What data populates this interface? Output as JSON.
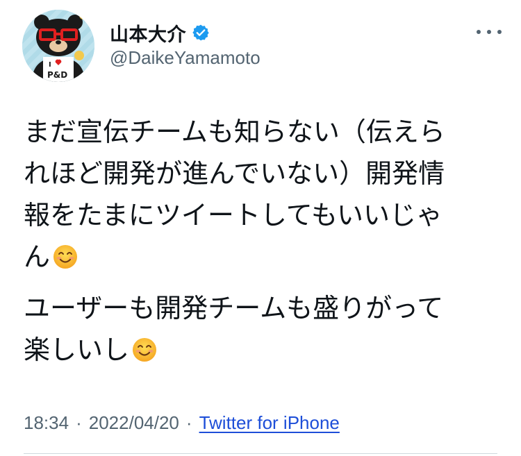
{
  "user": {
    "display_name": "山本大介",
    "handle": "@DaikeYamamoto",
    "verified": true,
    "avatar": {
      "icon": "bear-mascot-avatar",
      "background_color": "#bfe3ee",
      "shirt_text": "I ♥ P&D"
    }
  },
  "menu": {
    "icon": "more-horizontal-icon"
  },
  "tweet": {
    "lines_para1": [
      "まだ宣伝チームも知らない（伝えら",
      "れほど開発が進んでいない）開発情",
      "報をたまにツイートしてもいいじゃ",
      "ん"
    ],
    "lines_para2": [
      "ユーザーも開発チームも盛りがって",
      "楽しいし"
    ],
    "emoji": "smiling-face-icon"
  },
  "meta": {
    "time": "18:34",
    "separator": "·",
    "date": "2022/04/20",
    "source": "Twitter for iPhone"
  },
  "colors": {
    "text": "#0f1419",
    "secondary": "#536471",
    "link": "#1d4ed8",
    "verified": "#1d9bf0",
    "divider": "#cfd9de"
  }
}
